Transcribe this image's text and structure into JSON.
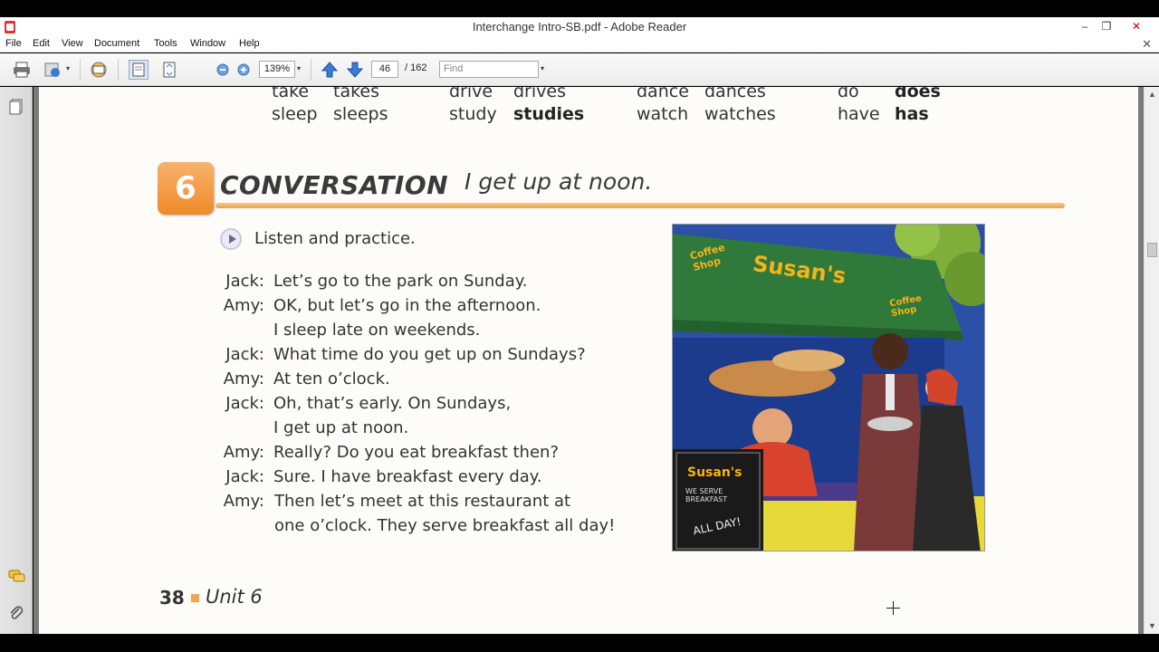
{
  "window": {
    "title": "Interchange Intro-SB.pdf - Adobe Reader",
    "controls": {
      "minimize": "–",
      "restore": "❐",
      "close": "✕"
    }
  },
  "menu": [
    "File",
    "Edit",
    "View",
    "Document",
    "Tools",
    "Window",
    "Help"
  ],
  "toolbar": {
    "zoom": "139%",
    "page_current": "46",
    "page_total": "/ 162",
    "find_placeholder": "Find"
  },
  "page": {
    "verbs_row1": [
      "take",
      "takes",
      "drive",
      "drives",
      "dance",
      "dances",
      "do",
      "does"
    ],
    "verbs_row2": [
      "sleep",
      "sleeps",
      "study",
      "studies",
      "watch",
      "watches",
      "have",
      "has"
    ],
    "section_number": "6",
    "section_title": "CONVERSATION",
    "section_subtitle": "I get up at noon.",
    "instruction": "Listen and practice.",
    "dialogue": [
      {
        "speaker": "Jack:",
        "line": "Let’s go to the park on Sunday."
      },
      {
        "speaker": "Amy:",
        "line": "OK, but let’s go in the afternoon."
      },
      {
        "speaker": "",
        "line": "I sleep late on weekends."
      },
      {
        "speaker": "Jack:",
        "line": "What time do you get up on Sundays?"
      },
      {
        "speaker": "Amy:",
        "line": "At ten o’clock."
      },
      {
        "speaker": "Jack:",
        "line": "Oh, that’s early. On Sundays,"
      },
      {
        "speaker": "",
        "line": "I get up at noon."
      },
      {
        "speaker": "Amy:",
        "line": "Really? Do you eat breakfast then?"
      },
      {
        "speaker": "Jack:",
        "line": "Sure. I have breakfast every day."
      },
      {
        "speaker": "Amy:",
        "line": "Then let’s meet at this restaurant at"
      },
      {
        "speaker": "",
        "line": "one o’clock. They serve breakfast all day!"
      }
    ],
    "page_number": "38",
    "unit_label": "Unit 6",
    "illustration": {
      "awning_text": "Susan's",
      "side_text_left": "Coffee Shop",
      "side_text_right": "Coffee Shop",
      "sign_title": "Susan's",
      "sign_line": "WE SERVE BREAKFAST",
      "sign_bottom": "ALL DAY!"
    }
  },
  "colors": {
    "accent_orange": "#ef8a2a",
    "awning_green": "#2f7a3a",
    "awning_text": "#f5b21a"
  }
}
